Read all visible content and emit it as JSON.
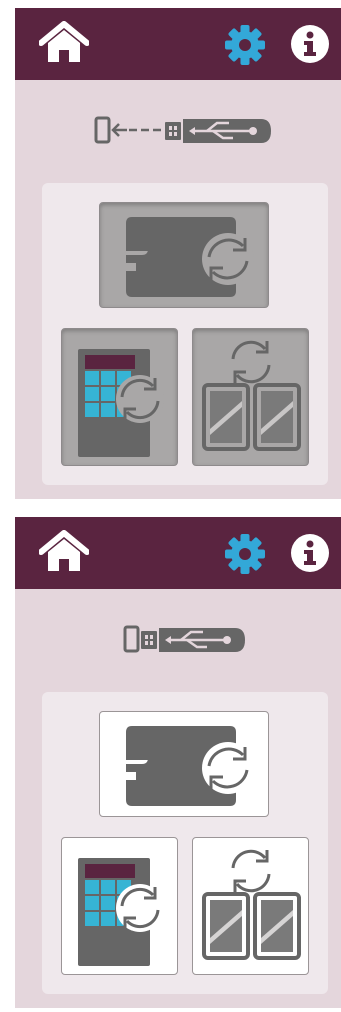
{
  "screens": [
    {
      "id": "screen-a",
      "state": "pressed",
      "connection_status": "disconnected",
      "header": {
        "icons": [
          "home-icon",
          "settings-gear-icon",
          "info-icon"
        ]
      },
      "tiles": [
        "sewing-machine-sync",
        "design-sync",
        "hoop-sync"
      ]
    },
    {
      "id": "screen-b",
      "state": "normal",
      "connection_status": "connected",
      "header": {
        "icons": [
          "home-icon",
          "settings-gear-icon",
          "info-icon"
        ]
      },
      "tiles": [
        "sewing-machine-sync",
        "design-sync",
        "hoop-sync"
      ]
    }
  ],
  "colors": {
    "header_bg": "#5a2440",
    "screen_bg": "#e4d6dc",
    "panel_bg": "#efe8ec",
    "accent_gear": "#33a8d8",
    "icon_gray": "#666666",
    "tile_pressed": "#a9a7a7",
    "tile_normal": "#ffffff",
    "design_header": "#5a2440",
    "design_cells": "#36b4d4"
  }
}
